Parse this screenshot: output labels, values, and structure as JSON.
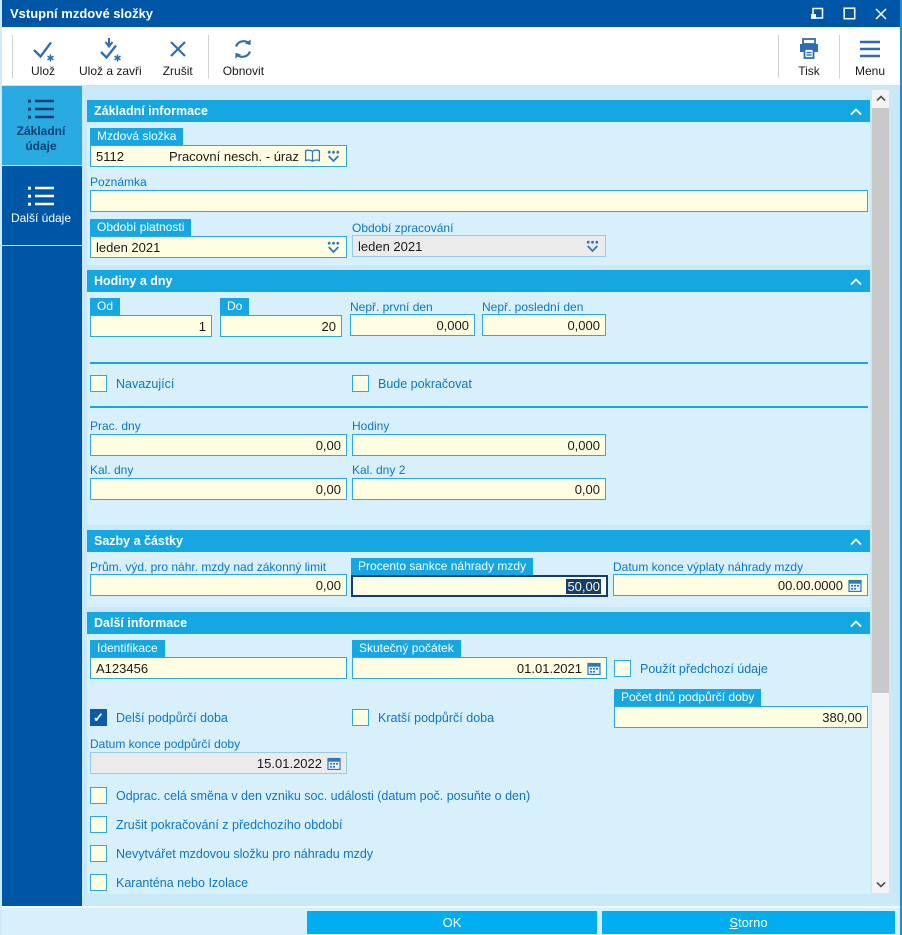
{
  "colors": {
    "titlebar_blue": "#0056A6",
    "section_header_cyan": "#14A7E1",
    "accent_cyan": "#29ABE2",
    "field_yellow": "#FFFDE2",
    "disabled_gray": "#EBEBEB",
    "focus_navy": "#123D72",
    "footer_button_cyan": "#00AEEF",
    "checkbox_checked_blue": "#0D5AA7"
  },
  "icons": {
    "save": "check-star-icon",
    "save_close": "down-arrow-check-icon",
    "cancel": "x-icon",
    "refresh": "refresh-arrows-icon",
    "print": "printer-icon",
    "menu": "hamburger-icon",
    "sidebar_tab": "list-icon",
    "combo_dropdown": "dots-chevron-icon",
    "lookup": "open-book-icon",
    "date": "calendar-icon",
    "section_collapse": "chevron-up-icon",
    "window_controls": [
      "restore-icon",
      "maximize-icon",
      "close-icon"
    ],
    "scrollbar": [
      "chevron-up-icon",
      "chevron-down-icon"
    ]
  },
  "titlebar": {
    "title": "Vstupní mzdové složky"
  },
  "toolbar": {
    "save": "Ulož",
    "save_close": "Ulož a zavři",
    "cancel": "Zrušit",
    "refresh": "Obnovit",
    "print": "Tisk",
    "menu": "Menu"
  },
  "sidebar": {
    "items": [
      {
        "label": "Základní údaje",
        "active": true
      },
      {
        "label": "Další údaje",
        "active": false
      }
    ]
  },
  "basic_info": {
    "title": "Základní informace",
    "wage_component": {
      "label": "Mzdová složka",
      "code": "5112",
      "name": "Pracovní nesch. - úraz"
    },
    "note": {
      "label": "Poznámka",
      "value": ""
    },
    "validity_period": {
      "label": "Období platnosti",
      "value": "leden 2021"
    },
    "processing_period": {
      "label": "Období zpracování",
      "value": "leden 2021"
    }
  },
  "hours_days": {
    "title": "Hodiny a dny",
    "from": {
      "label": "Od",
      "value": "1"
    },
    "to": {
      "label": "Do",
      "value": "20"
    },
    "absent_first_day": {
      "label": "Nepř. první den",
      "value": "0,000"
    },
    "absent_last_day": {
      "label": "Nepř. poslední den",
      "value": "0,000"
    },
    "continuing": {
      "label": "Navazující",
      "checked": false
    },
    "will_continue": {
      "label": "Bude pokračovat",
      "checked": false
    },
    "work_days": {
      "label": "Prac. dny",
      "value": "0,00"
    },
    "hours": {
      "label": "Hodiny",
      "value": "0,000"
    },
    "cal_days": {
      "label": "Kal. dny",
      "value": "0,00"
    },
    "cal_days2": {
      "label": "Kal. dny 2",
      "value": "0,00"
    }
  },
  "rates_amounts": {
    "title": "Sazby a částky",
    "avg_earnings": {
      "label": "Prům. výd. pro náhr. mzdy nad zákonný limit",
      "value": "0,00"
    },
    "sanction_percent": {
      "label": "Procento sankce náhrady mzdy",
      "value": "50,00"
    },
    "payout_end_date": {
      "label": "Datum konce výplaty náhrady mzdy",
      "value": "00.00.0000"
    }
  },
  "other_info": {
    "title": "Další informace",
    "identification": {
      "label": "Identifikace",
      "value": "A123456"
    },
    "actual_start": {
      "label": "Skutečný počátek",
      "value": "01.01.2021"
    },
    "use_previous": {
      "label": "Použít předchozí údaje",
      "checked": false
    },
    "longer_support": {
      "label": "Delší podpůrčí doba",
      "checked": true
    },
    "shorter_support": {
      "label": "Kratší podpůrčí doba",
      "checked": false
    },
    "support_days": {
      "label": "Počet dnů podpůrčí doby",
      "value": "380,00"
    },
    "support_end_date": {
      "label": "Datum konce podpůrčí doby",
      "value": "15.01.2022"
    },
    "checkboxes": [
      {
        "label": "Odprac. celá směna v den vzniku soc. události (datum poč. posuňte o den)",
        "checked": false
      },
      {
        "label": "Zrušit pokračování z předchozího období",
        "checked": false
      },
      {
        "label": "Nevytvářet mzdovou složku pro náhradu mzdy",
        "checked": false
      },
      {
        "label": "Karanténa nebo Izolace",
        "checked": false
      }
    ]
  },
  "footer": {
    "ok": "OK",
    "storno": "Storno"
  }
}
